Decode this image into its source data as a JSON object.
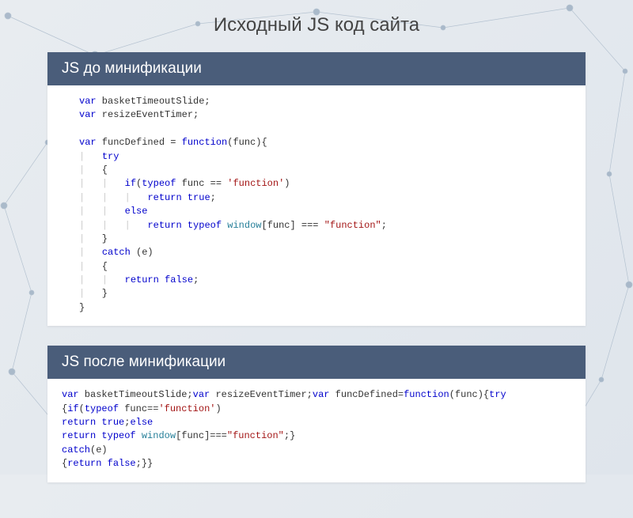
{
  "title": "Исходный JS код сайта",
  "panel1": {
    "header": "JS до минификации",
    "code_html": "<span class='kw'>var</span> basketTimeoutSlide;\n<span class='kw'>var</span> resizeEventTimer;\n\n<span class='kw'>var</span> funcDefined = <span class='kw'>function</span>(func){\n<span class='guide'>|</span>   <span class='kw'>try</span>\n<span class='guide'>|</span>   {\n<span class='guide'>|</span>   <span class='guide'>|</span>   <span class='kw'>if</span>(<span class='kw'>typeof</span> func == <span class='str'>'function'</span>)\n<span class='guide'>|</span>   <span class='guide'>|</span>   <span class='guide'>|</span>   <span class='kw'>return</span> <span class='kw'>true</span>;\n<span class='guide'>|</span>   <span class='guide'>|</span>   <span class='kw'>else</span>\n<span class='guide'>|</span>   <span class='guide'>|</span>   <span class='guide'>|</span>   <span class='kw'>return</span> <span class='kw'>typeof</span> <span class='obj'>window</span>[func] === <span class='str'>\"function\"</span>;\n<span class='guide'>|</span>   }\n<span class='guide'>|</span>   <span class='kw'>catch</span> (e)\n<span class='guide'>|</span>   {\n<span class='guide'>|</span>   <span class='guide'>|</span>   <span class='kw'>return</span> <span class='kw'>false</span>;\n<span class='guide'>|</span>   }\n}"
  },
  "panel2": {
    "header": "JS после минификации",
    "code_html": "<span class='kw'>var</span> basketTimeoutSlide;<span class='kw'>var</span> resizeEventTimer;<span class='kw'>var</span> funcDefined=<span class='kw'>function</span>(func){<span class='kw'>try</span>\n{<span class='kw'>if</span>(<span class='kw'>typeof</span> func==<span class='str'>'function'</span>)\n<span class='kw'>return</span> <span class='kw'>true</span>;<span class='kw'>else</span>\n<span class='kw'>return</span> <span class='kw'>typeof</span> <span class='obj'>window</span>[func]===<span class='str'>\"function\"</span>;}\n<span class='kw'>catch</span>(e)\n{<span class='kw'>return</span> <span class='kw'>false</span>;}}"
  }
}
